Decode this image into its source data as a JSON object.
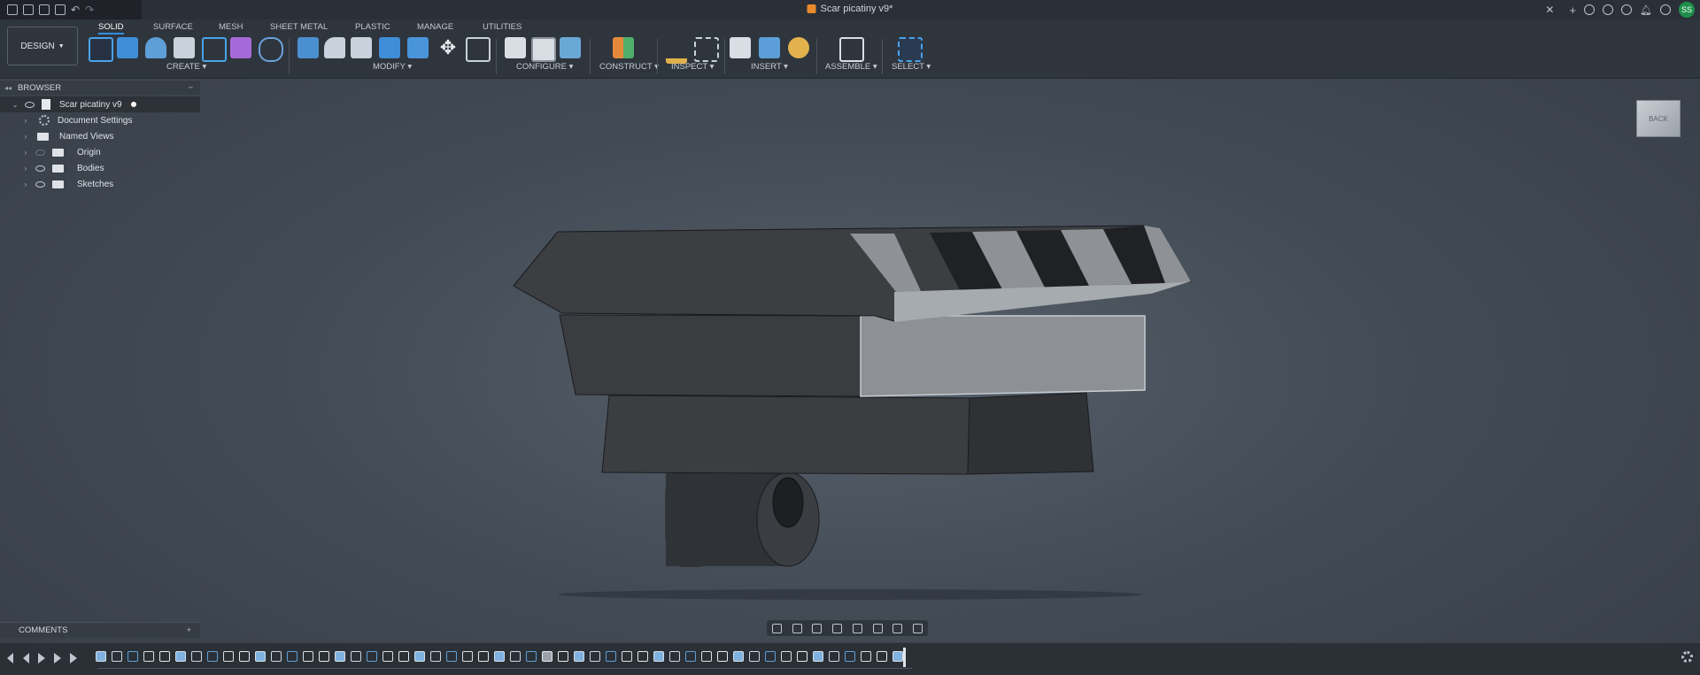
{
  "title_bar": {
    "document_title": "Scar picatiny v9*",
    "user_initials": "SS",
    "quick_access_icons": [
      "home-icon",
      "grid-icon",
      "file-icon",
      "save-icon",
      "undo-icon",
      "redo-icon"
    ],
    "window_icons": [
      "plus-icon",
      "activity-icon",
      "refresh-icon",
      "clock-icon",
      "bell-icon",
      "help-icon"
    ]
  },
  "toolbar": {
    "workspace_button": "DESIGN",
    "tabs": [
      "SOLID",
      "SURFACE",
      "MESH",
      "SHEET METAL",
      "PLASTIC",
      "MANAGE",
      "UTILITIES"
    ],
    "active_tab": "SOLID",
    "groups": [
      "CREATE",
      "MODIFY",
      "CONFIGURE",
      "CONSTRUCT",
      "INSPECT",
      "INSERT",
      "ASSEMBLE",
      "SELECT"
    ]
  },
  "browser": {
    "header": "BROWSER",
    "items": [
      {
        "label": "Scar picatiny v9",
        "icon": "document-icon"
      },
      {
        "label": "Document Settings",
        "icon": "gear-icon"
      },
      {
        "label": "Named Views",
        "icon": "folder-icon"
      },
      {
        "label": "Origin",
        "icon": "folder-icon"
      },
      {
        "label": "Bodies",
        "icon": "folder-icon"
      },
      {
        "label": "Sketches",
        "icon": "folder-icon"
      }
    ]
  },
  "viewcube": {
    "face": "BACK"
  },
  "comments": {
    "header": "COMMENTS",
    "add": "+"
  },
  "colors": {
    "accent": "#2f8fe3",
    "background": "#434b55",
    "selection": "#8a8e92"
  }
}
